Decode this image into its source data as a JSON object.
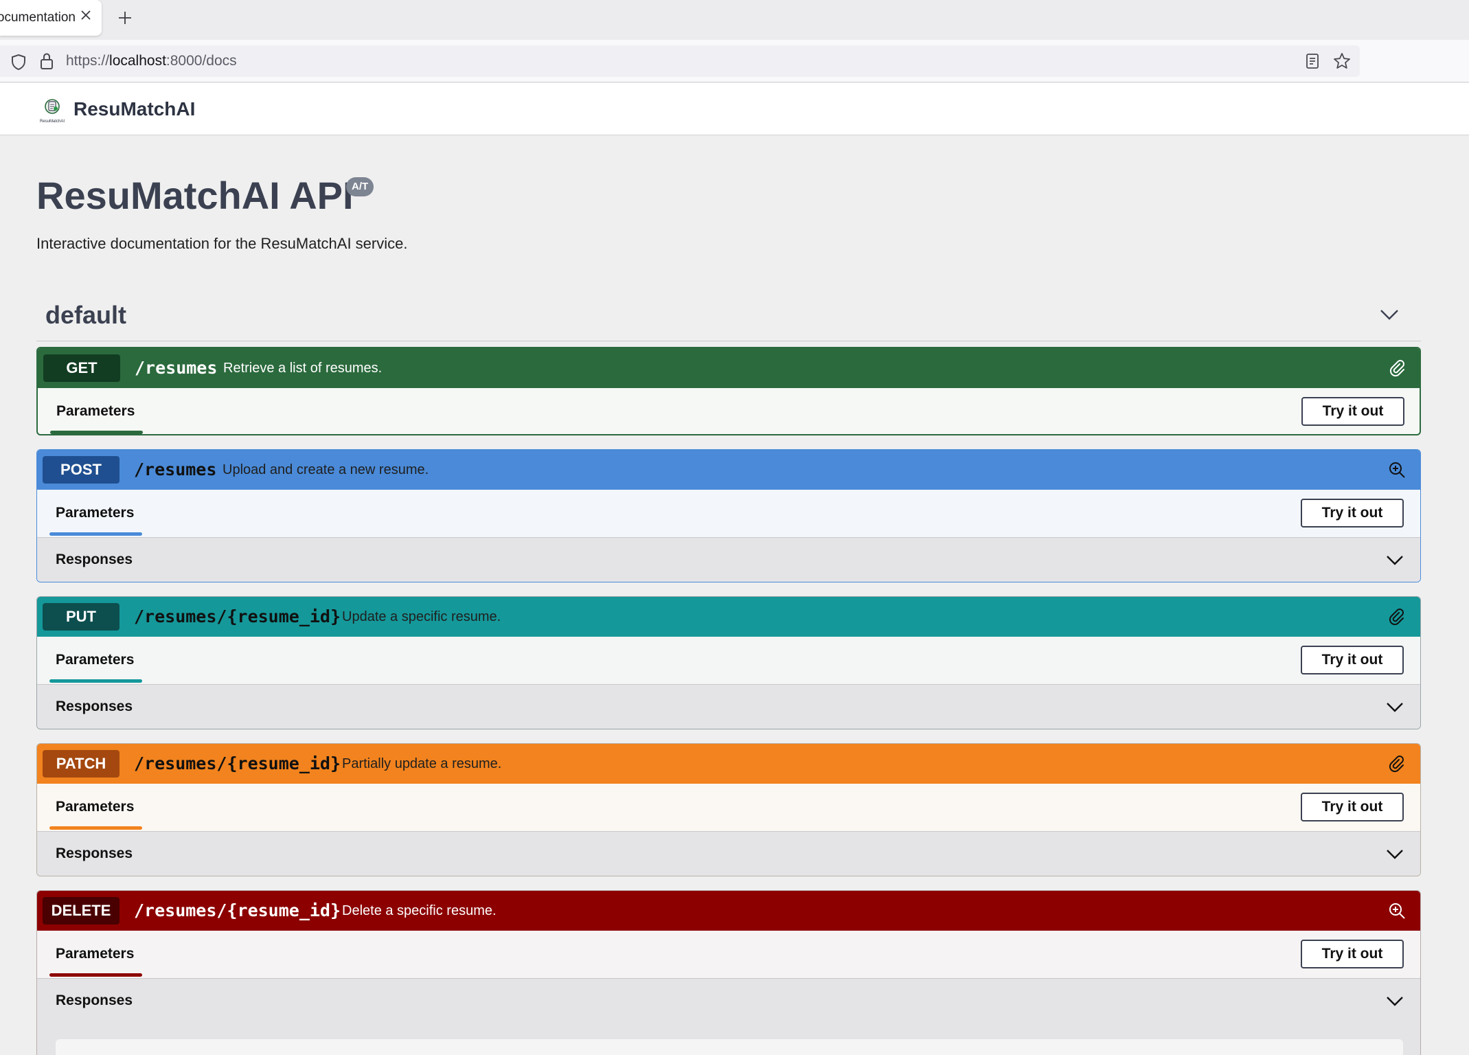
{
  "browser": {
    "tab_title": "ocumentation",
    "url_prefix": "https://",
    "url_host": "localhost",
    "url_rest": ":8000/docs"
  },
  "header": {
    "logo_text": "ResuMatchAI",
    "brand": "ResuMatchAI"
  },
  "info": {
    "title": "ResuMatchAI API",
    "version_badge": "A/T",
    "description": "Interactive documentation for the ResuMatchAI service."
  },
  "tag": {
    "name": "default"
  },
  "labels": {
    "parameters": "Parameters",
    "responses": "Responses",
    "try_it_out": "Try it out"
  },
  "operations": [
    {
      "method": "GET",
      "path": "/resumes",
      "summary": "Retrieve a list of resumes.",
      "icon": "link-icon",
      "color": "#2b6a3d",
      "badge_color": "#123d22"
    },
    {
      "method": "POST",
      "path": "/resumes",
      "summary": "Upload and create a new resume.",
      "icon": "zoom-in-icon",
      "color": "#4a8ad8",
      "badge_color": "#1f4f90"
    },
    {
      "method": "PUT",
      "path": "/resumes/{resume_id}",
      "summary": "Update a specific resume.",
      "icon": "link-icon",
      "color": "#15989a",
      "badge_color": "#0d4f4f"
    },
    {
      "method": "PATCH",
      "path": "/resumes/{resume_id}",
      "summary": "Partially update a resume.",
      "icon": "link-icon",
      "color": "#f2831e",
      "badge_color": "#a4480f"
    },
    {
      "method": "DELETE",
      "path": "/resumes/{resume_id}",
      "summary": "Delete a specific resume.",
      "icon": "zoom-in-icon",
      "color": "#8c0000",
      "badge_color": "#4a0000"
    }
  ]
}
